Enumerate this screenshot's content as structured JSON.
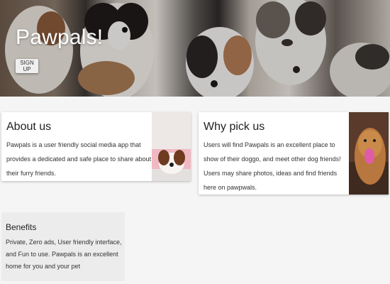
{
  "hero": {
    "title": "Pawpals!",
    "signup_label": "SIGN UP",
    "image": "puppies-photo"
  },
  "about": {
    "title": "About us",
    "body": "Pawpals is a user friendly social media app that provides a dedicated and safe place to share about their furry friends.",
    "image": "puppy-photo"
  },
  "why": {
    "title": "Why pick us",
    "body": "Users will find Pawpals is an excellent place to show of their doggo, and meet other dog friends! Users may share photos, ideas and find friends here on pawpwals.",
    "image": "golden-retriever-photo"
  },
  "benefits": {
    "title": "Benefits",
    "body": "Private, Zero ads, User friendly interface, and Fun to use. Pawpals is an excellent home for you and your pet"
  }
}
